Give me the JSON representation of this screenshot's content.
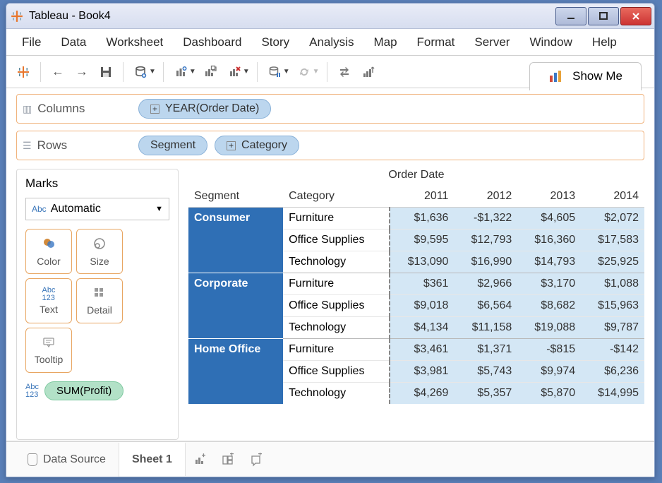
{
  "window": {
    "title": "Tableau - Book4"
  },
  "menu": [
    "File",
    "Data",
    "Worksheet",
    "Dashboard",
    "Story",
    "Analysis",
    "Map",
    "Format",
    "Server",
    "Window",
    "Help"
  ],
  "showme": "Show Me",
  "shelves": {
    "columns_label": "Columns",
    "rows_label": "Rows",
    "pills": {
      "columns": [
        {
          "label": "YEAR(Order Date)",
          "has_plus": true
        }
      ],
      "rows": [
        {
          "label": "Segment",
          "has_plus": false
        },
        {
          "label": "Category",
          "has_plus": true
        }
      ]
    }
  },
  "marks": {
    "title": "Marks",
    "type": "Automatic",
    "cards": [
      {
        "key": "color",
        "label": "Color"
      },
      {
        "key": "size",
        "label": "Size"
      },
      {
        "key": "text",
        "label": "Text"
      },
      {
        "key": "detail",
        "label": "Detail"
      },
      {
        "key": "tooltip",
        "label": "Tooltip"
      }
    ],
    "measure": "SUM(Profit)"
  },
  "crosstab": {
    "super_header": "Order Date",
    "seg_header": "Segment",
    "cat_header": "Category",
    "years": [
      "2011",
      "2012",
      "2013",
      "2014"
    ]
  },
  "chart_data": {
    "type": "table",
    "segments": [
      {
        "name": "Consumer",
        "rows": [
          {
            "category": "Furniture",
            "values": [
              "$1,636",
              "-$1,322",
              "$4,605",
              "$2,072"
            ]
          },
          {
            "category": "Office Supplies",
            "values": [
              "$9,595",
              "$12,793",
              "$16,360",
              "$17,583"
            ]
          },
          {
            "category": "Technology",
            "values": [
              "$13,090",
              "$16,990",
              "$14,793",
              "$25,925"
            ]
          }
        ]
      },
      {
        "name": "Corporate",
        "rows": [
          {
            "category": "Furniture",
            "values": [
              "$361",
              "$2,966",
              "$3,170",
              "$1,088"
            ]
          },
          {
            "category": "Office Supplies",
            "values": [
              "$9,018",
              "$6,564",
              "$8,682",
              "$15,963"
            ]
          },
          {
            "category": "Technology",
            "values": [
              "$4,134",
              "$11,158",
              "$19,088",
              "$9,787"
            ]
          }
        ]
      },
      {
        "name": "Home Office",
        "rows": [
          {
            "category": "Furniture",
            "values": [
              "$3,461",
              "$1,371",
              "-$815",
              "-$142"
            ]
          },
          {
            "category": "Office Supplies",
            "values": [
              "$3,981",
              "$5,743",
              "$9,974",
              "$6,236"
            ]
          },
          {
            "category": "Technology",
            "values": [
              "$4,269",
              "$5,357",
              "$5,870",
              "$14,995"
            ]
          }
        ]
      }
    ]
  },
  "bottom": {
    "datasource": "Data Source",
    "sheet": "Sheet 1"
  }
}
